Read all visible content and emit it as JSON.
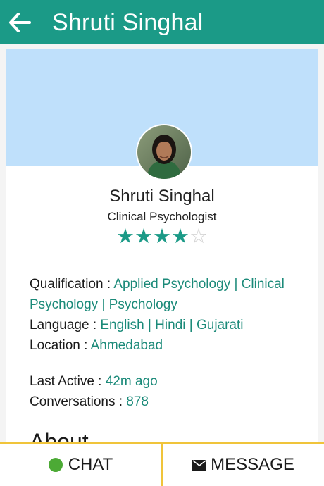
{
  "header": {
    "title": "Shruti Singhal",
    "back_icon": "back-arrow-icon"
  },
  "profile": {
    "name": "Shruti Singhal",
    "role": "Clinical Psychologist",
    "rating": 4,
    "rating_max": 5,
    "star_full": "★★★★",
    "star_empty": "☆",
    "qualification_label": "Qualification : ",
    "qualification_value": "Applied Psychology | Clinical Psychology | Psychology",
    "language_label": "Language : ",
    "language_value": "English | Hindi | Gujarati",
    "location_label": "Location : ",
    "location_value": "Ahmedabad",
    "last_active_label": "Last Active : ",
    "last_active_value": "42m ago",
    "conversations_label": "Conversations : ",
    "conversations_value": "878",
    "about_heading": "About"
  },
  "actions": {
    "chat_label": "CHAT",
    "message_label": "MESSAGE"
  },
  "colors": {
    "accent": "#1b9a87",
    "cover": "#bfe0fb",
    "online": "#4caa35",
    "divider": "#f0c43a"
  }
}
